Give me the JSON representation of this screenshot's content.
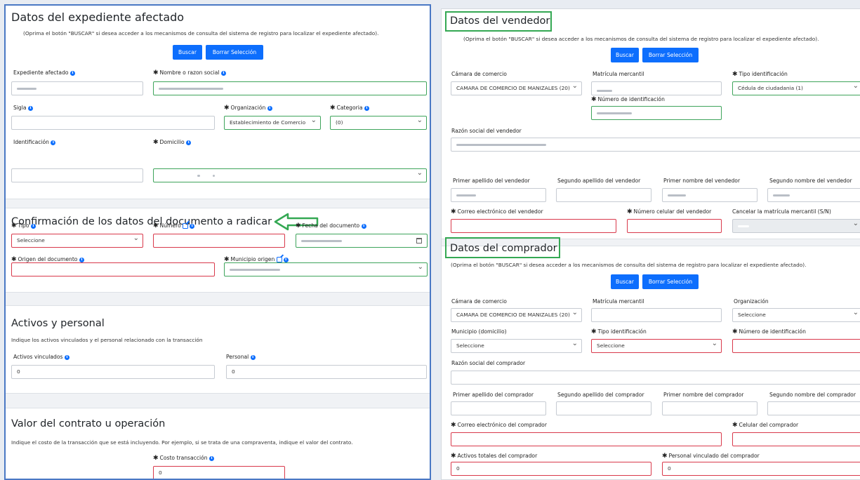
{
  "left": {
    "expediente": {
      "title": "Datos del expediente afectado",
      "hint": "(Oprima el botón \"BUSCAR\" si desea acceder a los mecanismos de consulta del sistema de registro para localizar el expediente afectado).",
      "buscar": "Buscar",
      "borrar": "Borrar Selección",
      "expediente_label": "Expediente afectado",
      "nombre_label": "Nombre o razon social",
      "sigla_label": "Sigla",
      "organizacion_label": "Organización",
      "organizacion_value": "Establecimiento de Comercio",
      "categoria_label": "Categoria",
      "categoria_value": "(0)",
      "identificacion_label": "Identificación",
      "domicilio_label": "Domicilio"
    },
    "confirmacion": {
      "title": "Confirmación de los datos del documento a radicar",
      "tipo_label": "Tipo",
      "tipo_value": "Seleccione",
      "numero_label": "Número",
      "fecha_label": "Fecha del documento",
      "origen_label": "Origen del documento",
      "municipio_label": "Municipio origen"
    },
    "activos": {
      "title": "Activos y personal",
      "hint": "Indique los activos vinculados y el personal relacionado con la transacción",
      "activos_label": "Activos vinculados",
      "activos_value": "0",
      "personal_label": "Personal",
      "personal_value": "0"
    },
    "valor": {
      "title": "Valor del contrato u operación",
      "hint": "Indique el costo de la transacción que se está incluyendo. Por ejemplo, si se trata de una compraventa, indique el valor del contrato.",
      "costo_label": "Costo transacción",
      "costo_value": "0"
    }
  },
  "right": {
    "vendedor": {
      "title": "Datos del vendedor",
      "hint": "(Oprima el botón \"BUSCAR\" si desea acceder a los mecanismos de consulta del sistema de registro para localizar el expediente afectado).",
      "buscar": "Buscar",
      "borrar": "Borrar Selección",
      "camara_label": "Cámara de comercio",
      "camara_value": "CAMARA DE COMERCIO DE MANIZALES (20)",
      "matricula_label": "Matrícula mercantil",
      "tipo_id_label": "Tipo identificación",
      "tipo_id_value": "Cédula de ciudadania (1)",
      "num_id_label": "Número de identificación",
      "razon_label": "Razón social del vendedor",
      "ape1_label": "Primer apellido del vendedor",
      "ape2_label": "Segundo apellido del vendedor",
      "nom1_label": "Primer nombre del vendedor",
      "nom2_label": "Segundo nombre del vendedor",
      "correo_label": "Correo electrónico del vendedor",
      "celular_label": "Número celular del vendedor",
      "cancelar_label": "Cancelar la matrícula mercantil (S/N)"
    },
    "comprador": {
      "title": "Datos del comprador",
      "hint": "(Oprima el botón \"BUSCAR\" si desea acceder a los mecanismos de consulta del sistema de registro para localizar el expediente afectado).",
      "buscar": "Buscar",
      "borrar": "Borrar Selección",
      "camara_label": "Cámara de comercio",
      "camara_value": "CAMARA DE COMERCIO DE MANIZALES (20)",
      "matricula_label": "Matrícula mercantil",
      "organizacion_label": "Organización",
      "organizacion_value": "Seleccione",
      "municipio_label": "Municipio (domicilio)",
      "municipio_value": "Seleccione",
      "tipo_id_label": "Tipo identificación",
      "tipo_id_value": "Seleccione",
      "num_id_label": "Número de identificación",
      "razon_label": "Razón social del comprador",
      "ape1_label": "Primer apellido del comprador",
      "ape2_label": "Segundo apellido del comprador",
      "nom1_label": "Primer nombre del comprador",
      "nom2_label": "Segundo nombre del comprador",
      "correo_label": "Correo electrónico del comprador",
      "celular_label": "Celular del comprador",
      "activos_label": "Activos totales del comprador",
      "activos_value": "0",
      "personal_label": "Personal vinculado del comprador",
      "personal_value": "0"
    }
  },
  "colors": {
    "primary": "#0d6efd",
    "invalid": "#d9394b",
    "valid": "#3ea45b",
    "highlight": "#34a853"
  }
}
